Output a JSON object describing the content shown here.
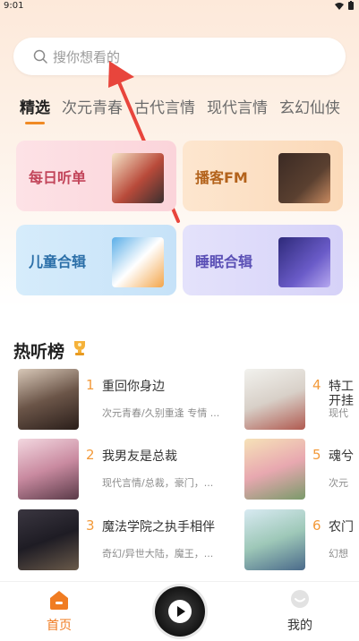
{
  "status": {
    "time": "9:01"
  },
  "search": {
    "placeholder": "搜你想看的"
  },
  "tabs": [
    {
      "label": "精选",
      "active": true
    },
    {
      "label": "次元青春"
    },
    {
      "label": "古代言情"
    },
    {
      "label": "现代言情"
    },
    {
      "label": "玄幻仙侠"
    }
  ],
  "categories": [
    {
      "label": "每日听单"
    },
    {
      "label": "播客FM"
    },
    {
      "label": "儿童合辑"
    },
    {
      "label": "睡眠合辑"
    }
  ],
  "hot": {
    "title": "热听榜",
    "left": [
      {
        "rank": "1",
        "title": "重回你身边",
        "sub": "次元青春/久别重逢 专情 ..."
      },
      {
        "rank": "2",
        "title": "我男友是总裁",
        "sub": "现代言情/总裁，豪门，..."
      },
      {
        "rank": "3",
        "title": "魔法学院之执手相伴",
        "sub": "奇幻/异世大陆，魔王，..."
      }
    ],
    "right": [
      {
        "rank": "4",
        "title": "特工",
        "title2": "开挂",
        "sub": "现代"
      },
      {
        "rank": "5",
        "title": "魂兮",
        "sub": "次元"
      },
      {
        "rank": "6",
        "title": "农门",
        "sub": "幻想"
      }
    ]
  },
  "nav": {
    "home": "首页",
    "mine": "我的"
  },
  "colors": {
    "accent": "#f08a24",
    "arrow": "#e8453c"
  }
}
